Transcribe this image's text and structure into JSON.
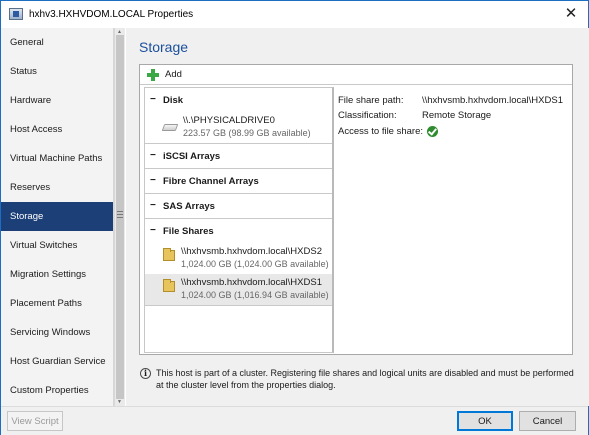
{
  "window": {
    "title": "hxhv3.HXHVDOM.LOCAL Properties",
    "close_glyph": "✕"
  },
  "nav": {
    "items": [
      {
        "label": "General"
      },
      {
        "label": "Status"
      },
      {
        "label": "Hardware"
      },
      {
        "label": "Host Access"
      },
      {
        "label": "Virtual Machine Paths"
      },
      {
        "label": "Reserves"
      },
      {
        "label": "Storage",
        "active": true
      },
      {
        "label": "Virtual Switches"
      },
      {
        "label": "Migration Settings"
      },
      {
        "label": "Placement Paths"
      },
      {
        "label": "Servicing Windows"
      },
      {
        "label": "Host Guardian Service"
      },
      {
        "label": "Custom Properties"
      }
    ]
  },
  "page": {
    "title": "Storage"
  },
  "toolbar": {
    "add_label": "Add",
    "add_icon": "plus-icon"
  },
  "storage": {
    "groups": [
      {
        "label": "Disk",
        "collapse_glyph": "−",
        "items": [
          {
            "name": "\\\\.\\PHYSICALDRIVE0",
            "detail": "223.57 GB (98.99 GB available)",
            "icon": "drive-icon"
          }
        ]
      },
      {
        "label": "iSCSI Arrays",
        "collapse_glyph": "−",
        "items": []
      },
      {
        "label": "Fibre Channel Arrays",
        "collapse_glyph": "−",
        "items": []
      },
      {
        "label": "SAS Arrays",
        "collapse_glyph": "−",
        "items": []
      },
      {
        "label": "File Shares",
        "collapse_glyph": "−",
        "items": [
          {
            "name": "\\\\hxhvsmb.hxhvdom.local\\HXDS2",
            "detail": "1,024.00 GB (1,024.00 GB available)",
            "icon": "file-share-icon"
          },
          {
            "name": "\\\\hxhvsmb.hxhvdom.local\\HXDS1",
            "detail": "1,024.00 GB (1,016.94 GB available)",
            "icon": "file-share-icon",
            "selected": true
          }
        ]
      }
    ]
  },
  "details": {
    "path_label": "File share path:",
    "path_value": "\\\\hxhvsmb.hxhvdom.local\\HXDS1",
    "classification_label": "Classification:",
    "classification_value": "Remote Storage",
    "access_label": "Access to file share:",
    "access_icon": "check-icon",
    "access_color": "#2e8b2e"
  },
  "info": {
    "icon_glyph": "i",
    "text": "This host is part of a cluster. Registering file shares and logical units are disabled and must be performed at the cluster level from the properties dialog."
  },
  "footer": {
    "view_script_label": "View Script",
    "ok_label": "OK",
    "cancel_label": "Cancel"
  },
  "colors": {
    "accent": "#1c3f77",
    "title_blue": "#1b4f9c",
    "add_green": "#39a845"
  }
}
